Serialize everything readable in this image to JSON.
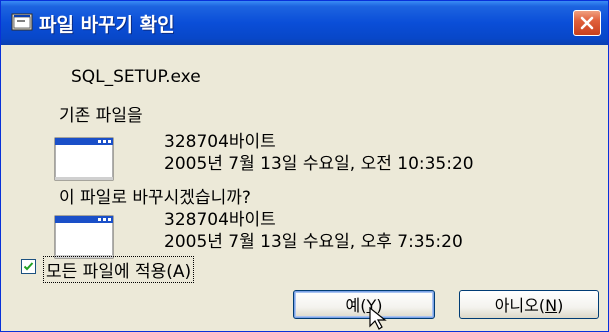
{
  "window": {
    "title": "파일 바꾸기 확인",
    "colors": {
      "titlebar": "#0a4ed8",
      "close": "#d8542e",
      "face": "#ece9d8"
    }
  },
  "filename": "SQL_SETUP.exe",
  "existing": {
    "heading": "기존 파일을",
    "size": "328704바이트",
    "modified": "2005년 7월 13일 수요일, 오전 10:35:20"
  },
  "question": "이 파일로 바꾸시겠습니까?",
  "replacement": {
    "size": "328704바이트",
    "modified": "2005년 7월 13일 수요일, 오후 7:35:20"
  },
  "apply_all": {
    "label": "모든 파일에 적용(A)",
    "checked": true
  },
  "buttons": {
    "yes": {
      "label": "예(",
      "key": "Y",
      "close": ")"
    },
    "no": {
      "label": "아니오(",
      "key": "N",
      "close": ")"
    }
  },
  "icons": {
    "title": "app-window-icon",
    "close": "close-x-icon",
    "file": "window-file-icon",
    "cursor": "mouse-pointer-icon"
  }
}
